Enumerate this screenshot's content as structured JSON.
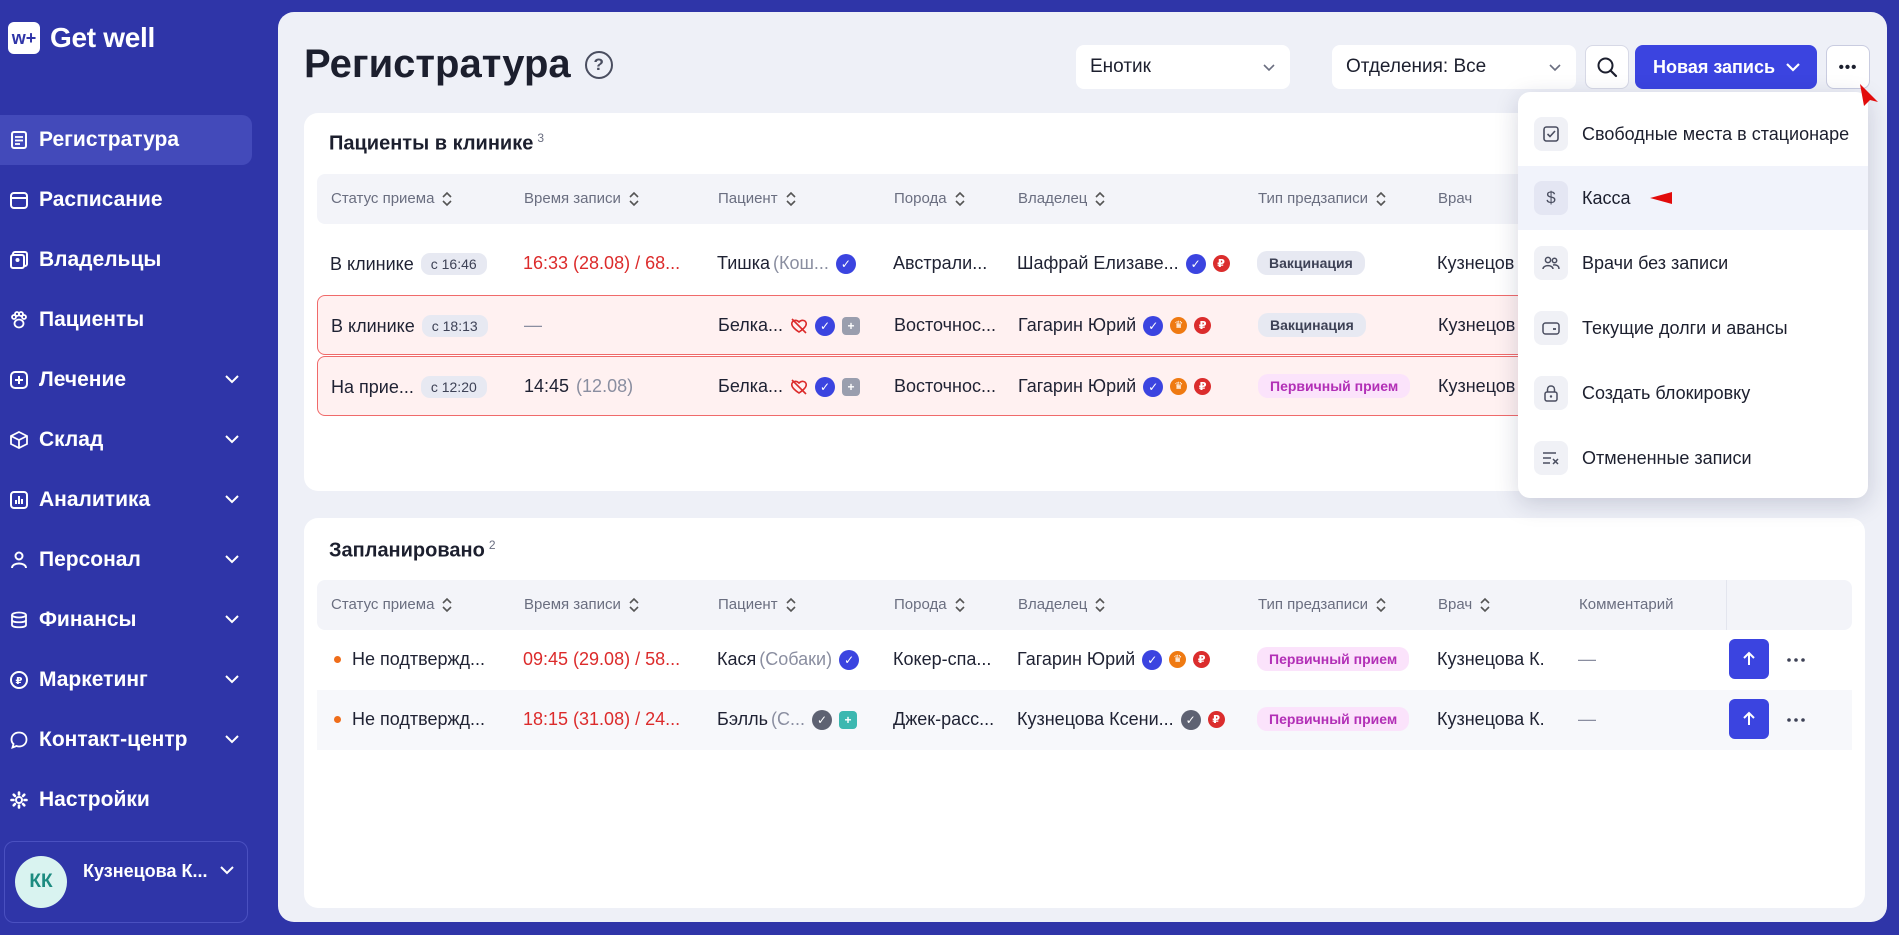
{
  "app": {
    "logo_mark": "w+",
    "logo_text": "Get well"
  },
  "sidebar": {
    "items": [
      {
        "label": "Регистратура",
        "icon": "register-icon",
        "active": true,
        "chevron": false
      },
      {
        "label": "Расписание",
        "icon": "calendar-icon",
        "active": false,
        "chevron": false
      },
      {
        "label": "Владельцы",
        "icon": "owners-icon",
        "active": false,
        "chevron": false
      },
      {
        "label": "Пациенты",
        "icon": "paw-icon",
        "active": false,
        "chevron": false
      },
      {
        "label": "Лечение",
        "icon": "plus-square-icon",
        "active": false,
        "chevron": true
      },
      {
        "label": "Склад",
        "icon": "box-icon",
        "active": false,
        "chevron": true
      },
      {
        "label": "Аналитика",
        "icon": "chart-icon",
        "active": false,
        "chevron": true
      },
      {
        "label": "Персонал",
        "icon": "person-icon",
        "active": false,
        "chevron": true
      },
      {
        "label": "Финансы",
        "icon": "coins-icon",
        "active": false,
        "chevron": true
      },
      {
        "label": "Маркетинг",
        "icon": "ruble-circle-icon",
        "active": false,
        "chevron": true
      },
      {
        "label": "Контакт-центр",
        "icon": "chat-icon",
        "active": false,
        "chevron": true
      },
      {
        "label": "Настройки",
        "icon": "gear-icon",
        "active": false,
        "chevron": false
      }
    ],
    "user": {
      "initials": "КК",
      "name": "Кузнецова К..."
    }
  },
  "header": {
    "title": "Регистратура",
    "help": "?",
    "clinic_select": "Енотик",
    "department_select": "Отделения: Все",
    "new_record_label": "Новая запись",
    "more": "•••"
  },
  "columns": {
    "status": "Статус приема",
    "time": "Время записи",
    "patient": "Пациент",
    "breed": "Порода",
    "owner": "Владелец",
    "type": "Тип предзаписи",
    "doctor": "Врач",
    "comment": "Комментарий"
  },
  "in_clinic": {
    "title": "Пациенты в клинике",
    "count": "3",
    "rows": [
      {
        "status": "В клинике",
        "since": "с 16:46",
        "time": "16:33 (28.08) / 68...",
        "time_color": "red",
        "patient": "Тишка",
        "patient_sub": "(Кош...",
        "breed": "Австрали...",
        "owner": "Шафрай Елизаве...",
        "type": "Вакцинация",
        "type_style": "grey",
        "doctor": "Кузнецов",
        "alert": false
      },
      {
        "status": "В клинике",
        "since": "с 18:13",
        "time": "—",
        "time_color": "grey",
        "patient": "Белка...",
        "patient_sub": "",
        "breed": "Восточнос...",
        "owner": "Гагарин Юрий",
        "type": "Вакцинация",
        "type_style": "grey",
        "doctor": "Кузнецов",
        "alert": true
      },
      {
        "status": "На прие...",
        "since": "с 12:20",
        "time": "14:45",
        "time_extra": "(12.08)",
        "time_color": "normal",
        "patient": "Белка...",
        "patient_sub": "",
        "breed": "Восточнос...",
        "owner": "Гагарин Юрий",
        "type": "Первичный прием",
        "type_style": "purple",
        "doctor": "Кузнецов",
        "alert": true
      }
    ]
  },
  "planned": {
    "title": "Запланировано",
    "count": "2",
    "rows": [
      {
        "status": "Не подтвержд...",
        "time": "09:45 (29.08) / 58...",
        "patient": "Кася",
        "patient_sub": "(Собаки)",
        "breed": "Кокер-спа...",
        "owner": "Гагарин Юрий",
        "type": "Первичный прием",
        "doctor": "Кузнецова К.",
        "comment": "—"
      },
      {
        "status": "Не подтвержд...",
        "time": "18:15 (31.08) / 24...",
        "patient": "Бэлль",
        "patient_sub": "(С...",
        "breed": "Джек-расс...",
        "owner": "Кузнецова Ксени...",
        "type": "Первичный прием",
        "doctor": "Кузнецова К.",
        "comment": "—"
      }
    ]
  },
  "menu": {
    "items": [
      {
        "label": "Свободные места в стационаре",
        "icon": "checkbox-icon"
      },
      {
        "label": "Касса",
        "icon": "dollar-icon",
        "hover": true
      },
      {
        "label": "Врачи без записи",
        "icon": "doctors-icon"
      },
      {
        "label": "Текущие долги и авансы",
        "icon": "wallet-icon"
      },
      {
        "label": "Создать блокировку",
        "icon": "lock-icon"
      },
      {
        "label": "Отмененные записи",
        "icon": "cancel-list-icon"
      }
    ]
  },
  "colors": {
    "sidebar_bg": "#2f35a8",
    "accent": "#3b44e0",
    "alert_border": "#f06a6a",
    "red_text": "#dc2b2b",
    "purple_chip": "#b22fb6"
  }
}
